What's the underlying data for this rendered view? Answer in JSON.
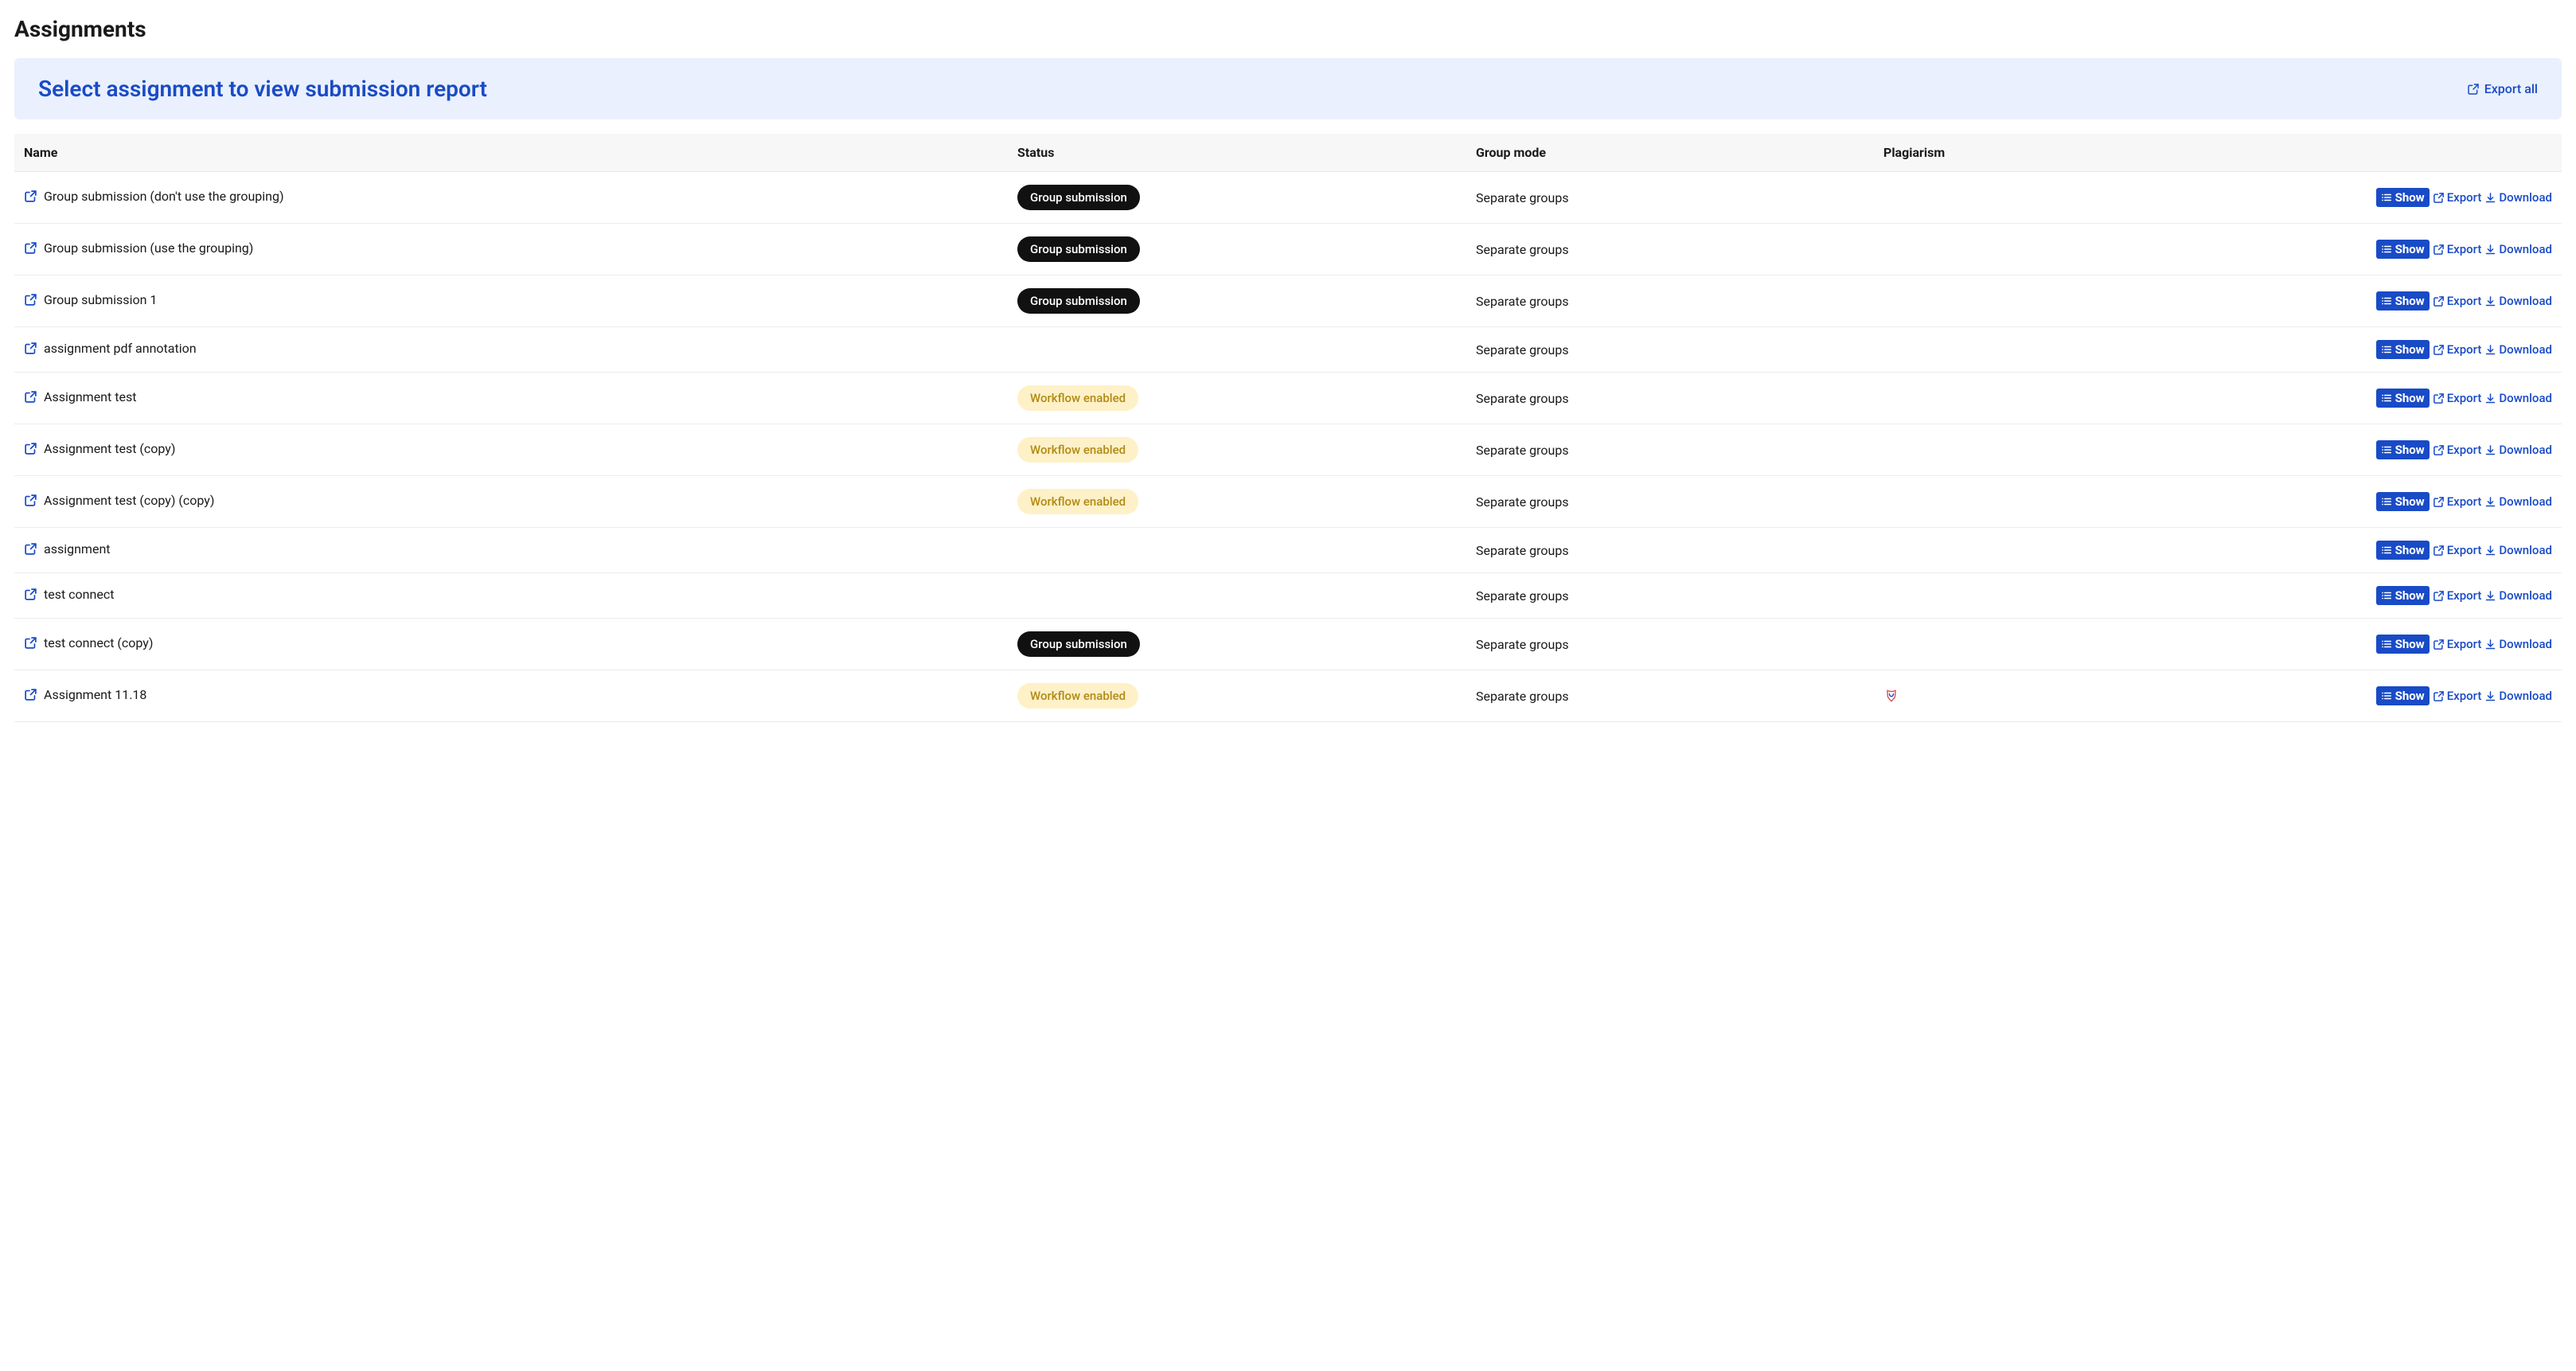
{
  "page": {
    "title": "Assignments"
  },
  "banner": {
    "title": "Select assignment to view submission report",
    "export_all": "Export all"
  },
  "columns": {
    "name": "Name",
    "status": "Status",
    "group_mode": "Group mode",
    "plagiarism": "Plagiarism"
  },
  "status_badges": {
    "group_submission": "Group submission",
    "workflow_enabled": "Workflow enabled"
  },
  "actions": {
    "show": "Show",
    "export": "Export",
    "download": "Download"
  },
  "rows": [
    {
      "name": "Group submission (don't use the grouping)",
      "status": "group_submission",
      "group_mode": "Separate groups",
      "plagiarism": false
    },
    {
      "name": "Group submission (use the grouping)",
      "status": "group_submission",
      "group_mode": "Separate groups",
      "plagiarism": false
    },
    {
      "name": "Group submission 1",
      "status": "group_submission",
      "group_mode": "Separate groups",
      "plagiarism": false
    },
    {
      "name": "assignment pdf annotation",
      "status": null,
      "group_mode": "Separate groups",
      "plagiarism": false
    },
    {
      "name": "Assignment test",
      "status": "workflow_enabled",
      "group_mode": "Separate groups",
      "plagiarism": false
    },
    {
      "name": "Assignment test (copy)",
      "status": "workflow_enabled",
      "group_mode": "Separate groups",
      "plagiarism": false
    },
    {
      "name": "Assignment test (copy) (copy)",
      "status": "workflow_enabled",
      "group_mode": "Separate groups",
      "plagiarism": false
    },
    {
      "name": "assignment",
      "status": null,
      "group_mode": "Separate groups",
      "plagiarism": false
    },
    {
      "name": "test connect",
      "status": null,
      "group_mode": "Separate groups",
      "plagiarism": false
    },
    {
      "name": "test connect (copy)",
      "status": "group_submission",
      "group_mode": "Separate groups",
      "plagiarism": false
    },
    {
      "name": "Assignment 11.18",
      "status": "workflow_enabled",
      "group_mode": "Separate groups",
      "plagiarism": true
    }
  ]
}
